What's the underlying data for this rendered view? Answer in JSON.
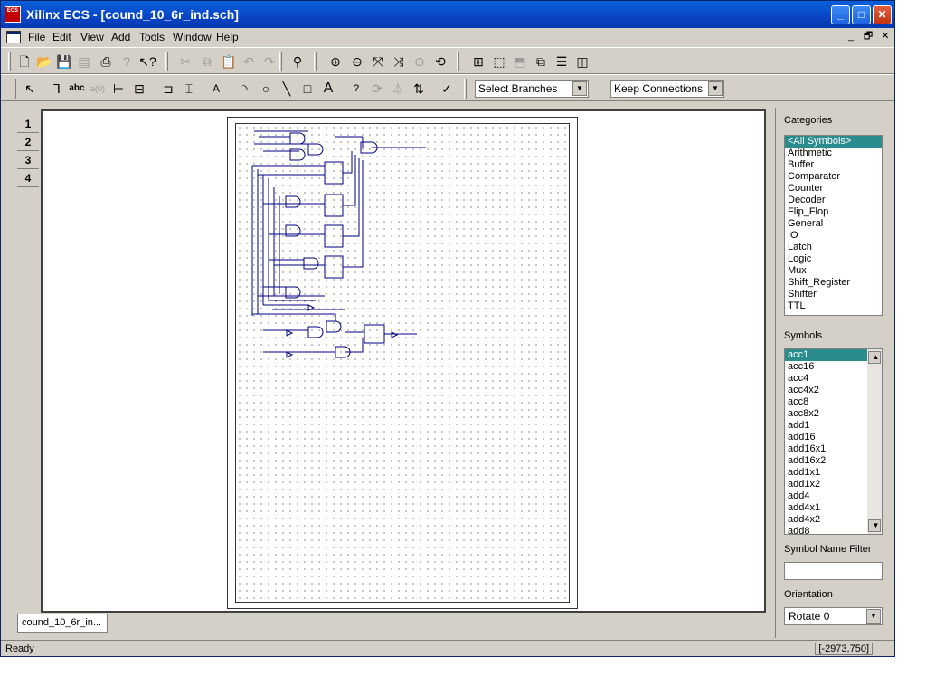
{
  "window": {
    "app_icon_text": "ECS",
    "title": "Xilinx ECS - [cound_10_6r_ind.sch]",
    "buttons": {
      "minimize": "_",
      "maximize": "□",
      "close": "✕"
    }
  },
  "menubar": {
    "items": [
      {
        "label": "File"
      },
      {
        "label": "Edit"
      },
      {
        "label": "View"
      },
      {
        "label": "Add"
      },
      {
        "label": "Tools"
      },
      {
        "label": "Window"
      },
      {
        "label": "Help"
      }
    ],
    "mdi_buttons": {
      "minimize": "_",
      "restore": "🗗",
      "close": "✕"
    }
  },
  "toolbar1": {
    "icons": [
      "new-icon",
      "open-icon",
      "save-icon",
      "save-all-icon",
      "print-icon",
      "help-icon",
      "context-help-icon",
      "cut-icon",
      "copy-icon",
      "paste-icon",
      "undo-icon",
      "redo-icon",
      "find-icon",
      "zoom-in-icon",
      "zoom-out-icon",
      "zoom-full-icon",
      "zoom-fit-icon",
      "zoom-selection-icon",
      "refresh-icon",
      "hierarchy-icon",
      "push-icon",
      "pop-icon",
      "cascade-icon",
      "tile-horizontal-icon",
      "tile-vertical-icon"
    ]
  },
  "toolbar2": {
    "icons": [
      "select-icon",
      "add-wire-icon",
      "net-name-icon",
      "rename-bus-icon",
      "bus-tap-icon",
      "io-marker-icon",
      "add-symbol-icon",
      "add-instance-icon",
      "text-icon",
      "arc-icon",
      "circle-icon",
      "line-icon",
      "rectangle-icon",
      "add-text-icon",
      "query-icon",
      "rotate-icon",
      "mirror-icon",
      "flip-icon",
      "check-icon"
    ],
    "text_glyphs": {
      "abc": "abc",
      "ab": "a(0)",
      "text_A": "A",
      "query": "?"
    },
    "branch_select": "Select Branches",
    "connection_select": "Keep Connections"
  },
  "pages": [
    "1",
    "2",
    "3",
    "4"
  ],
  "document_tab": "cound_10_6r_in...",
  "panel": {
    "categories_label": "Categories",
    "categories": [
      "<All Symbols>",
      "Arithmetic",
      "Buffer",
      "Comparator",
      "Counter",
      "Decoder",
      "Flip_Flop",
      "General",
      "IO",
      "Latch",
      "Logic",
      "Mux",
      "Shift_Register",
      "Shifter",
      "TTL"
    ],
    "selected_category": "<All Symbols>",
    "symbols_label": "Symbols",
    "symbols": [
      "acc1",
      "acc16",
      "acc4",
      "acc4x2",
      "acc8",
      "acc8x2",
      "add1",
      "add16",
      "add16x1",
      "add16x2",
      "add1x1",
      "add1x2",
      "add4",
      "add4x1",
      "add4x2",
      "add8"
    ],
    "selected_symbol": "acc1",
    "filter_label": "Symbol Name Filter",
    "filter_value": "",
    "orientation_label": "Orientation",
    "orientation_value": "Rotate 0"
  },
  "status": {
    "left": "Ready",
    "coords": "[-2973,750]"
  },
  "colors": {
    "title_bar": "#0845c5",
    "selection": "#2a8c8c",
    "schematic_wire": "#000080"
  }
}
